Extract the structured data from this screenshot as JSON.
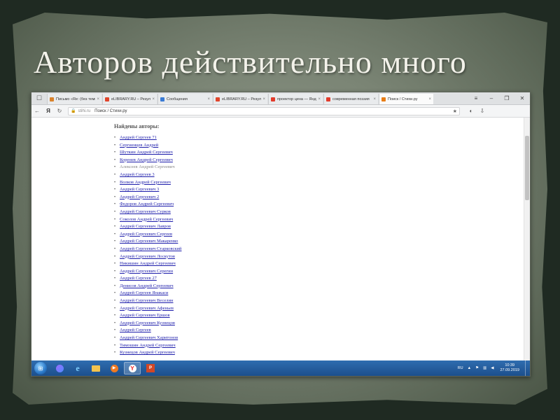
{
  "slide": {
    "title": "Авторов действительно много"
  },
  "browser": {
    "tabs": [
      {
        "label": "Письмо «Re: (без темы)»",
        "color": "#d9822b",
        "active": false
      },
      {
        "label": "eLIBRARY.RU – Результаты",
        "color": "#e0452b",
        "active": false
      },
      {
        "label": "Сообщения",
        "color": "#3a7bd5",
        "active": false
      },
      {
        "label": "eLIBRARY.RU – Результаты",
        "color": "#e0452b",
        "active": false
      },
      {
        "label": "проектор цена — Яндекс",
        "color": "#e23b2b",
        "active": false
      },
      {
        "label": "современная поэзия",
        "color": "#e23b2b",
        "active": false
      },
      {
        "label": "Поиск / Стихи.ру",
        "color": "#e87d16",
        "active": true
      }
    ],
    "address": {
      "domain": "stihi.ru",
      "text": "Поиск / Стихи.ру"
    },
    "ya_logo": "Я"
  },
  "page": {
    "heading": "Найдены авторы:",
    "authors": [
      {
        "name": "Андрей Сергеев 71",
        "visited": false
      },
      {
        "name": "Сергиенцев Андрей",
        "visited": false
      },
      {
        "name": "Шуткин Андрей Сергеевич",
        "visited": false
      },
      {
        "name": "Коренев Андрей Сергеевич",
        "visited": false
      },
      {
        "name": "Алексеев Андрей Сергеевич",
        "visited": true
      },
      {
        "name": "Андрей Сергеев 3",
        "visited": false
      },
      {
        "name": "Волков Андрей Сергеевич",
        "visited": false
      },
      {
        "name": "Андрей Сергеевич 3",
        "visited": false
      },
      {
        "name": "Андрей Сергеевич 2",
        "visited": false
      },
      {
        "name": "Федоров Андрей Сергеевич",
        "visited": false
      },
      {
        "name": "Андрей Сергеевич Сурков",
        "visited": false
      },
      {
        "name": "Соколов Андрей Сергеевич",
        "visited": false
      },
      {
        "name": "Андрей Сергеевич Лавров",
        "visited": false
      },
      {
        "name": "Андрей Сергеевич Сергеев",
        "visited": false
      },
      {
        "name": "Андрей Сергеевич Макаренко",
        "visited": false
      },
      {
        "name": "Андрей Сергеевич Старковский",
        "visited": false
      },
      {
        "name": "Андрей Сергеевич Лоскутов",
        "visited": false
      },
      {
        "name": "Никишин Андрей Сергеевич",
        "visited": false
      },
      {
        "name": "Андрей Сергеевич Серегин",
        "visited": false
      },
      {
        "name": "Андрей Сергеев 27",
        "visited": false
      },
      {
        "name": "Денисов Андрей Сергеевич",
        "visited": false
      },
      {
        "name": "Андрей Сергеев Янакаси",
        "visited": false
      },
      {
        "name": "Андрей Сергеевич Веселин",
        "visited": false
      },
      {
        "name": "Андрей Сергеевич Афеньев",
        "visited": false
      },
      {
        "name": "Андрей Сергеевич Ершов",
        "visited": false
      },
      {
        "name": "Андрей Сергеевич Кузнецов",
        "visited": false
      },
      {
        "name": "Андрей Сергеев",
        "visited": false
      },
      {
        "name": "Андрей Сергеевич Харитонов",
        "visited": false
      },
      {
        "name": "Тимошин Андрей Сергеевич",
        "visited": false
      },
      {
        "name": "Кузнецов Андрей Сергеевич",
        "visited": false
      }
    ]
  },
  "taskbar": {
    "language": "RU",
    "time": "10:39",
    "date": "27.09.2019"
  }
}
